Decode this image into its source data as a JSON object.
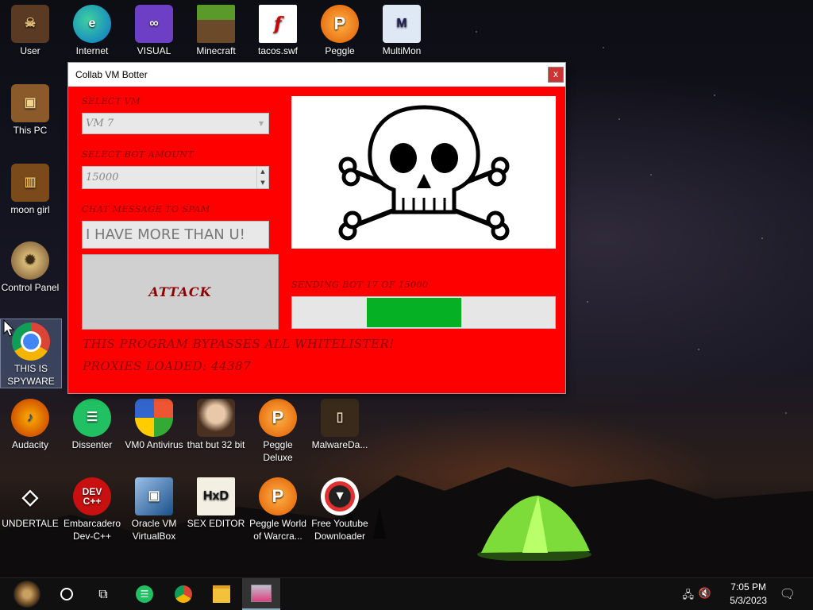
{
  "desktop": {
    "icons": [
      {
        "label": "User",
        "icon": "user-folder-icon"
      },
      {
        "label": "Internet",
        "icon": "edge-browser-icon"
      },
      {
        "label": "VISUAL",
        "icon": "visual-studio-icon"
      },
      {
        "label": "Minecraft",
        "icon": "minecraft-icon"
      },
      {
        "label": "tacos.swf",
        "icon": "flash-file-icon"
      },
      {
        "label": "Peggle",
        "icon": "peggle-icon"
      },
      {
        "label": "MultiMon",
        "icon": "multimon-icon"
      },
      {
        "label": "This PC",
        "icon": "computer-icon"
      },
      {
        "label": "moon girl",
        "icon": "moon-girl-icon"
      },
      {
        "label": "Control Panel",
        "icon": "control-panel-icon"
      },
      {
        "label": "THIS IS SPYWARE",
        "icon": "chrome-icon"
      },
      {
        "label": "Audacity",
        "icon": "audacity-icon"
      },
      {
        "label": "Dissenter",
        "icon": "dissenter-icon"
      },
      {
        "label": "VM0 Antivirus",
        "icon": "shield-icon"
      },
      {
        "label": "that but 32 bit",
        "icon": "portrait-icon"
      },
      {
        "label": "Peggle Deluxe",
        "icon": "peggle-icon"
      },
      {
        "label": "MalwareDa...",
        "icon": "folder-icon"
      },
      {
        "label": "UNDERTALE",
        "icon": "unity-icon"
      },
      {
        "label": "Embarcadero Dev-C++",
        "icon": "devcpp-icon"
      },
      {
        "label": "Oracle VM VirtualBox",
        "icon": "virtualbox-icon"
      },
      {
        "label": "SEX EDITOR",
        "icon": "hxd-icon"
      },
      {
        "label": "Peggle World of Warcra...",
        "icon": "peggle-icon"
      },
      {
        "label": "Free Youtube Downloader",
        "icon": "youtube-downloader-icon"
      }
    ],
    "colors": {
      "window_bg": "#ff0000",
      "label_text": "#8b0000",
      "progress_fill": "#06b025"
    }
  },
  "window": {
    "title": "Collab VM Botter",
    "close_label": "x",
    "select_vm_label": "SELECT VM",
    "select_vm_value": "VM 7",
    "bot_amount_label": "SELECT BOT AMOUNT",
    "bot_amount_value": "15000",
    "chat_label": "CHAT MESSAGE TO SPAM",
    "chat_value": "I HAVE MORE THAN U!",
    "attack_label": "ATTACK",
    "status_text": "SENDING BOT 17 OF 15000",
    "progress": 0.36,
    "bypass_text": "THIS PROGRAM BYPASSES ALL WHITELISTER!",
    "proxies_text": "PROXIES LOADED: 44387",
    "image_icon": "skull-crossbones-icon"
  },
  "taskbar": {
    "time": "7:05 PM",
    "date": "5/3/2023",
    "items": [
      "start-icon",
      "cortana-icon",
      "task-view-icon",
      "dissenter-icon",
      "chrome-icon",
      "file-explorer-icon",
      "app-window-icon"
    ]
  }
}
